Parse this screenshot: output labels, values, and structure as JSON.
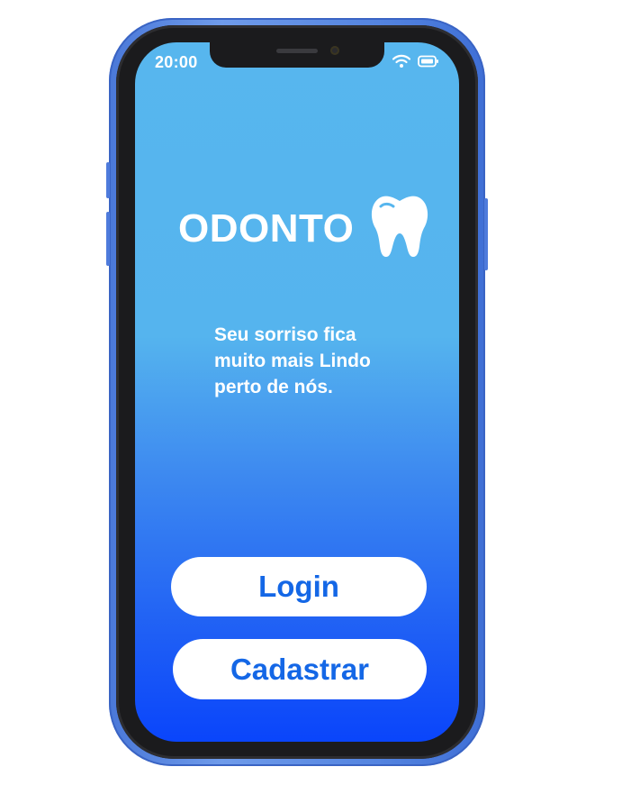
{
  "status_bar": {
    "time": "20:00",
    "icons": [
      "wifi-icon",
      "battery-icon"
    ]
  },
  "brand": {
    "title": "ODONTO",
    "icon": "tooth-icon"
  },
  "tagline": {
    "line1": "Seu sorriso fica",
    "line2": "muito mais Lindo",
    "line3": "perto de nós."
  },
  "actions": {
    "login_label": "Login",
    "signup_label": "Cadastrar"
  },
  "colors": {
    "frame": "#5585e0",
    "gradient_top": "#57b6ee",
    "gradient_bottom": "#0a45fb",
    "button_bg": "#ffffff",
    "button_text": "#1467e6",
    "text": "#ffffff"
  }
}
